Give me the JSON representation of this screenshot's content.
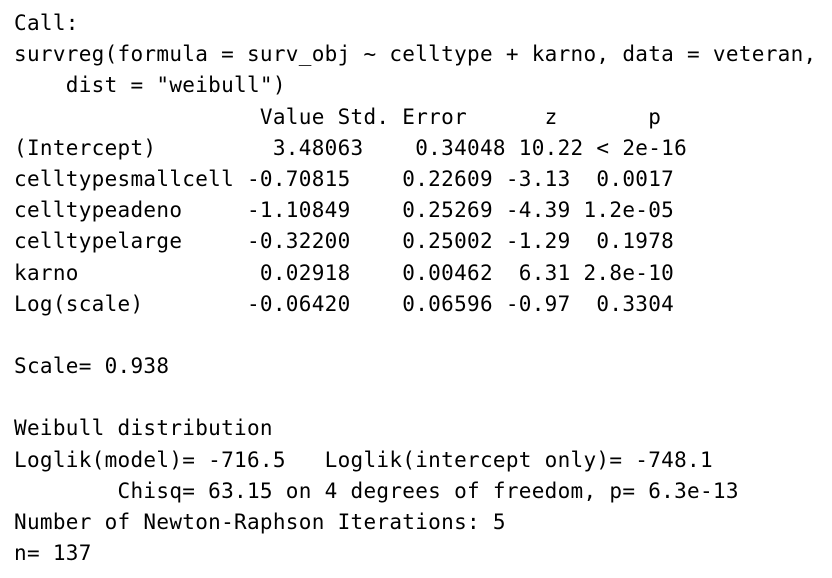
{
  "output": {
    "call_header": "Call:",
    "call_line1": "survreg(formula = surv_obj ~ celltype + karno, data = veteran,",
    "call_line2": "    dist = \"weibull\")",
    "table_header": "                   Value Std. Error      z       p",
    "rows": [
      "(Intercept)         3.48063    0.34048 10.22 < 2e-16",
      "celltypesmallcell -0.70815    0.22609 -3.13  0.0017",
      "celltypeadeno     -1.10849    0.25269 -4.39 1.2e-05",
      "celltypelarge     -0.32200    0.25002 -1.29  0.1978",
      "karno              0.02918    0.00462  6.31 2.8e-10",
      "Log(scale)        -0.06420    0.06596 -0.97  0.3304"
    ],
    "scale": "Scale= 0.938",
    "distribution": "Weibull distribution",
    "loglik": "Loglik(model)= -716.5   Loglik(intercept only)= -748.1",
    "chisq": "        Chisq= 63.15 on 4 degrees of freedom, p= 6.3e-13",
    "iterations": "Number of Newton-Raphson Iterations: 5",
    "n": "n= 137"
  }
}
